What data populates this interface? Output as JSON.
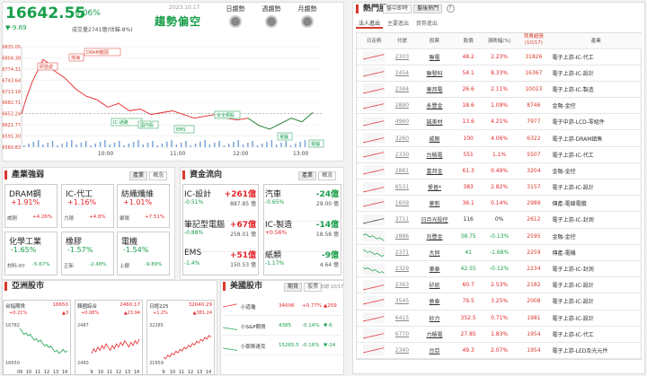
{
  "header": {
    "index": "16642.55",
    "change_pct": "-0.06%",
    "change": "▼-9.69",
    "volume": "成交量2741億(估貓-8%)",
    "date": "2023.10.17",
    "trend": "趨勢偏空",
    "views": [
      {
        "label": "日趨勢"
      },
      {
        "label": "週趨勢"
      },
      {
        "label": "月趨勢"
      }
    ]
  },
  "chart_data": {
    "type": "line",
    "y_ticks": [
      "16835.05",
      "16804.38",
      "16774.31",
      "16743.64",
      "16713.18",
      "16682.71",
      "16652.24",
      "16621.77",
      "16591.30",
      "16560.83"
    ],
    "x_ticks": [
      "10:00",
      "11:00",
      "12:00",
      "13:00"
    ],
    "ylim": [
      16560.83,
      16835.05
    ],
    "x": [
      0,
      5,
      10,
      15,
      20,
      25,
      30,
      40,
      50,
      60,
      70,
      80,
      90,
      100,
      110,
      120,
      130,
      140,
      150,
      160,
      170,
      180,
      190,
      200,
      210,
      220,
      230,
      240,
      250,
      260,
      270
    ],
    "y": [
      16652,
      16700,
      16740,
      16770,
      16800,
      16790,
      16770,
      16750,
      16720,
      16700,
      16690,
      16670,
      16680,
      16660,
      16665,
      16650,
      16655,
      16660,
      16650,
      16640,
      16645,
      16650,
      16640,
      16635,
      16640,
      16620,
      16610,
      16625,
      16640,
      16630,
      16655
    ],
    "annotations": [
      "研發處",
      "鴻海",
      "DRAM鏡頭",
      "IC-通路",
      "國內股",
      "EMS",
      "安全類股",
      "電腦",
      "電腦2"
    ]
  },
  "sector": {
    "title": "產業強弱",
    "tabs": [
      "產業",
      "概念"
    ],
    "cards": [
      {
        "name": "DRAM鋼",
        "pct": "+1.91%",
        "stock": "威剛",
        "spct": "+4.26%",
        "color": "#e4262b"
      },
      {
        "name": "IC-代工",
        "pct": "+1.16%",
        "stock": "力積",
        "spct": "+4.8%",
        "color": "#e4262b"
      },
      {
        "name": "紡織纖維",
        "pct": "+1.01%",
        "stock": "聚陽",
        "spct": "+7.51%",
        "color": "#e4262b"
      },
      {
        "name": "化學工業",
        "pct": "-1.65%",
        "stock": "材料-KY",
        "spct": "-5.67%",
        "color": "#179e4a"
      },
      {
        "name": "橡膠",
        "pct": "-1.57%",
        "stock": "正新",
        "spct": "-2.48%",
        "color": "#179e4a"
      },
      {
        "name": "電機",
        "pct": "-1.54%",
        "stock": "上銀",
        "spct": "-9.89%",
        "color": "#179e4a"
      }
    ]
  },
  "fund": {
    "title": "資金流向",
    "tabs": [
      "產業",
      "概念"
    ],
    "left": [
      {
        "name": "IC-設計",
        "pct": "-0.51%",
        "amount": "+261億",
        "sub": "887.85 億",
        "color": "#e4262b"
      },
      {
        "name": "筆記型電腦",
        "pct": "-0.88%",
        "amount": "+67億",
        "sub": "258.01 億",
        "color": "#e4262b"
      },
      {
        "name": "EMS",
        "pct": "-1.4%",
        "amount": "+51億",
        "sub": "150.53 億",
        "color": "#e4262b"
      }
    ],
    "right": [
      {
        "name": "汽車",
        "pct": "-0.65%",
        "amount": "-24億",
        "sub": "29.00 億",
        "color": "#179e4a"
      },
      {
        "name": "IC-製造",
        "pct": "+0.56%",
        "amount": "-14億",
        "sub": "18.58 億",
        "color": "#179e4a"
      },
      {
        "name": "紙類",
        "pct": "-1.17%",
        "amount": "-9億",
        "sub": "4.64 億",
        "color": "#179e4a"
      }
    ]
  },
  "asia": {
    "title": "亞洲股市",
    "markets": [
      {
        "name": "台指期貨",
        "val": "16650",
        "chg": "+0.21%",
        "diff": "▲3",
        "c": "#e4262b",
        "lo": "16782",
        "hi": "16650",
        "x": [
          "09",
          "10",
          "11",
          "12",
          "13",
          "14"
        ]
      },
      {
        "name": "韓國綜合",
        "val": "2460.17",
        "chg": "+0.08%",
        "diff": "▲23.94",
        "c": "#e4262b",
        "lo": "2487",
        "hi": "2460",
        "x": [
          "9",
          "10",
          "11",
          "12",
          "13",
          "14"
        ]
      },
      {
        "name": "日經225",
        "val": "32040.29",
        "chg": "+1.2%",
        "diff": "▲381.24",
        "c": "#e4262b",
        "lo": "32285",
        "hi": "31659",
        "x": [
          "9",
          "10",
          "11",
          "12",
          "13",
          "14"
        ]
      }
    ]
  },
  "us": {
    "title": "美國股市",
    "tabs": [
      "期貨",
      "股票"
    ],
    "date": "日期 10/17",
    "rows": [
      {
        "name": "小道瓊",
        "val": "34006",
        "pct": "+0.77%",
        "diff": "▲259",
        "c": "#e4262b"
      },
      {
        "name": "小S&P期貨",
        "val": "4385",
        "pct": "-0.14%",
        "diff": "▼-6",
        "c": "#179e4a"
      },
      {
        "name": "小那斯達克",
        "val": "15265.5",
        "pct": "-0.16%",
        "diff": "▼-24",
        "c": "#179e4a"
      }
    ]
  },
  "hot": {
    "title": "熱門股",
    "tabs": [
      "盤中即時",
      "盤後熱門"
    ],
    "subtabs": [
      "法人進出",
      "主要進出",
      "資券進出"
    ],
    "columns": [
      "日走勢",
      "代號",
      "股票",
      "股價",
      "漲跌幅(%)",
      "買賣超張\n(10/17)",
      "產業"
    ],
    "rows": [
      {
        "code": "2303",
        "name": "聯電",
        "price": "48.2",
        "pct": "2.23%",
        "vol": "31826",
        "ind": "電子上游-IC-代工",
        "c": "#e4262b"
      },
      {
        "code": "2454",
        "name": "聯發科",
        "price": "54.1",
        "pct": "8.33%",
        "vol": "16367",
        "ind": "電子上游-IC-設計",
        "c": "#e4262b"
      },
      {
        "code": "2344",
        "name": "華邦電",
        "price": "26.6",
        "pct": "2.11%",
        "vol": "10023",
        "ind": "電子上游-IC-製造",
        "c": "#e4262b"
      },
      {
        "code": "2890",
        "name": "永豐金",
        "price": "18.6",
        "pct": "1.09%",
        "vol": "8746",
        "ind": "金融-金控",
        "c": "#e4262b"
      },
      {
        "code": "4960",
        "name": "誠美材",
        "price": "13.6",
        "pct": "4.21%",
        "vol": "7977",
        "ind": "電子中游-LCD-零組件",
        "c": "#e4262b"
      },
      {
        "code": "3260",
        "name": "威剛",
        "price": "100",
        "pct": "4.06%",
        "vol": "6322",
        "ind": "電子上游-DRAM鎮售",
        "c": "#e4262b"
      },
      {
        "code": "2330",
        "name": "台積電",
        "price": "551",
        "pct": "1.1%",
        "vol": "5507",
        "ind": "電子上游-IC-代工",
        "c": "#e4262b"
      },
      {
        "code": "2881",
        "name": "富邦金",
        "price": "61.3",
        "pct": "0.49%",
        "vol": "3204",
        "ind": "金融-金控",
        "c": "#e4262b"
      },
      {
        "code": "6531",
        "name": "愛普*",
        "price": "383",
        "pct": "2.82%",
        "vol": "3157",
        "ind": "電子上游-IC-設計",
        "c": "#e4262b"
      },
      {
        "code": "1609",
        "name": "華新",
        "price": "36.1",
        "pct": "0.14%",
        "vol": "2989",
        "ind": "傳產-電線電纜",
        "c": "#e4262b"
      },
      {
        "code": "3711",
        "name": "日月光投控",
        "price": "116",
        "pct": "0%",
        "vol": "2612",
        "ind": "電子上游-IC-封測",
        "c": "#333"
      },
      {
        "code": "2886",
        "name": "兆豐金",
        "price": "38.75",
        "pct": "-0.13%",
        "vol": "2595",
        "ind": "金融-金控",
        "c": "#179e4a"
      },
      {
        "code": "2371",
        "name": "大同",
        "price": "41",
        "pct": "-1.68%",
        "vol": "2259",
        "ind": "傳產-電機",
        "c": "#179e4a"
      },
      {
        "code": "2329",
        "name": "華泰",
        "price": "42.55",
        "price2": "",
        "pct": "-0.12%",
        "vol": "2234",
        "ind": "電子上游-IC-封測",
        "c": "#179e4a"
      },
      {
        "code": "2363",
        "name": "矽統",
        "price": "60.7",
        "pct": "2.53%",
        "vol": "2182",
        "ind": "電子上游-IC-設計",
        "c": "#e4262b"
      },
      {
        "code": "3545",
        "name": "敦泰",
        "price": "79.5",
        "pct": "3.25%",
        "vol": "2008",
        "ind": "電子上游-IC-設計",
        "c": "#e4262b"
      },
      {
        "code": "6415",
        "name": "砂力",
        "price": "352.5",
        "pct": "0.71%",
        "vol": "1981",
        "ind": "電子上游-IC-設計",
        "c": "#e4262b"
      },
      {
        "code": "6770",
        "name": "力積電",
        "price": "27.85",
        "pct": "1.83%",
        "vol": "1954",
        "ind": "電子上游-IC-代工",
        "c": "#e4262b"
      },
      {
        "code": "2340",
        "name": "台亞",
        "price": "49.3",
        "pct": "2.07%",
        "vol": "1954",
        "ind": "電子上游-LED及光元件",
        "c": "#e4262b"
      }
    ]
  }
}
